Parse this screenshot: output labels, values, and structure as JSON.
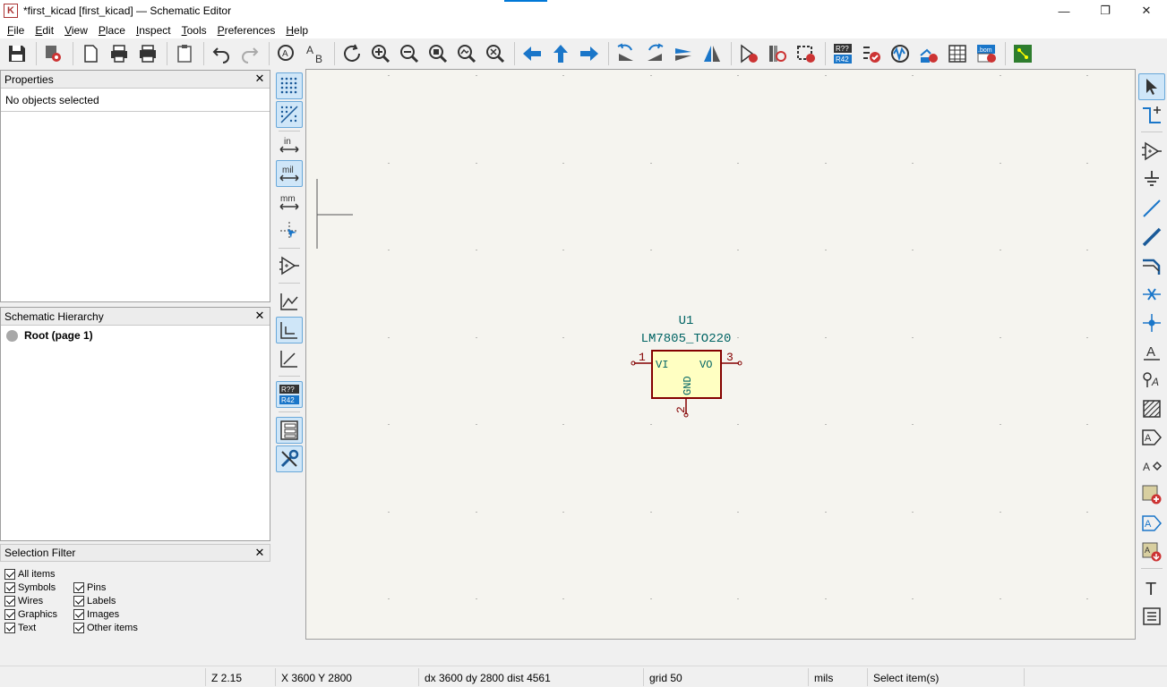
{
  "window": {
    "title": "*first_kicad [first_kicad] — Schematic Editor",
    "app_icon_letter": "K",
    "minimize": "—",
    "restore": "❐",
    "close": "✕"
  },
  "menu": [
    {
      "label": "File",
      "key": "F",
      "rest": "ile"
    },
    {
      "label": "Edit",
      "key": "E",
      "rest": "dit"
    },
    {
      "label": "View",
      "key": "V",
      "rest": "iew"
    },
    {
      "label": "Place",
      "key": "P",
      "rest": "lace"
    },
    {
      "label": "Inspect",
      "key": "I",
      "rest": "nspect"
    },
    {
      "label": "Tools",
      "key": "T",
      "rest": "ools"
    },
    {
      "label": "Preferences",
      "key": "P",
      "rest": "references"
    },
    {
      "label": "Help",
      "key": "H",
      "rest": "elp"
    }
  ],
  "properties": {
    "title": "Properties",
    "status": "No objects selected"
  },
  "hierarchy": {
    "title": "Schematic Hierarchy",
    "root": "Root (page 1)"
  },
  "selection_filter": {
    "title": "Selection Filter",
    "items": {
      "all": "All items",
      "symbols": "Symbols",
      "pins": "Pins",
      "wires": "Wires",
      "labels": "Labels",
      "graphics": "Graphics",
      "images": "Images",
      "text": "Text",
      "other": "Other items"
    }
  },
  "left_toolbar": {
    "inches": "in",
    "mils": "mil",
    "millimeters": "mm",
    "annotate": "R??",
    "annotate2": "R42"
  },
  "top_toolbar": {
    "annotate": "R??",
    "annotate2": "R42",
    "bom": ".bom"
  },
  "right_toolbar": {
    "label_a": "A",
    "text_t": "T"
  },
  "component": {
    "reference": "U1",
    "value": "LM7805_TO220",
    "pin1_num": "1",
    "pin2_num": "2",
    "pin3_num": "3",
    "pin1_name": "VI",
    "pin2_name": "GND",
    "pin3_name": "VO"
  },
  "colors": {
    "canvas_bg": "#f5f4ef",
    "component_fill": "#ffffc2",
    "component_stroke": "#840000",
    "field_text": "#006464",
    "accent": "#0078d7",
    "icon_blue": "#1a76c9"
  },
  "status": {
    "zoom": "Z 2.15",
    "cursor": "X 3600  Y 2800",
    "delta": "dx 3600  dy 2800  dist 4561",
    "grid": "grid 50",
    "units": "mils",
    "tool": "Select item(s)"
  }
}
